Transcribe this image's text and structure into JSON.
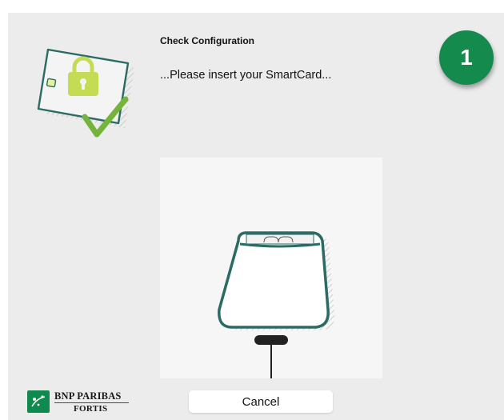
{
  "dialog": {
    "title": "Check Configuration",
    "message": "...Please insert your SmartCard...",
    "step_number": "1",
    "cancel_label": "Cancel"
  },
  "logo": {
    "line1": "BNP PARIBAS",
    "line2": "FORTIS"
  },
  "icons": {
    "card": "smartcard-lock-check-icon",
    "reader": "card-reader-icon"
  },
  "colors": {
    "brand_green": "#148a4c",
    "reader_teal": "#2c6b63",
    "lock_green": "#c4dc54",
    "check_green": "#74b43a",
    "logo_red": "#c8102e"
  }
}
